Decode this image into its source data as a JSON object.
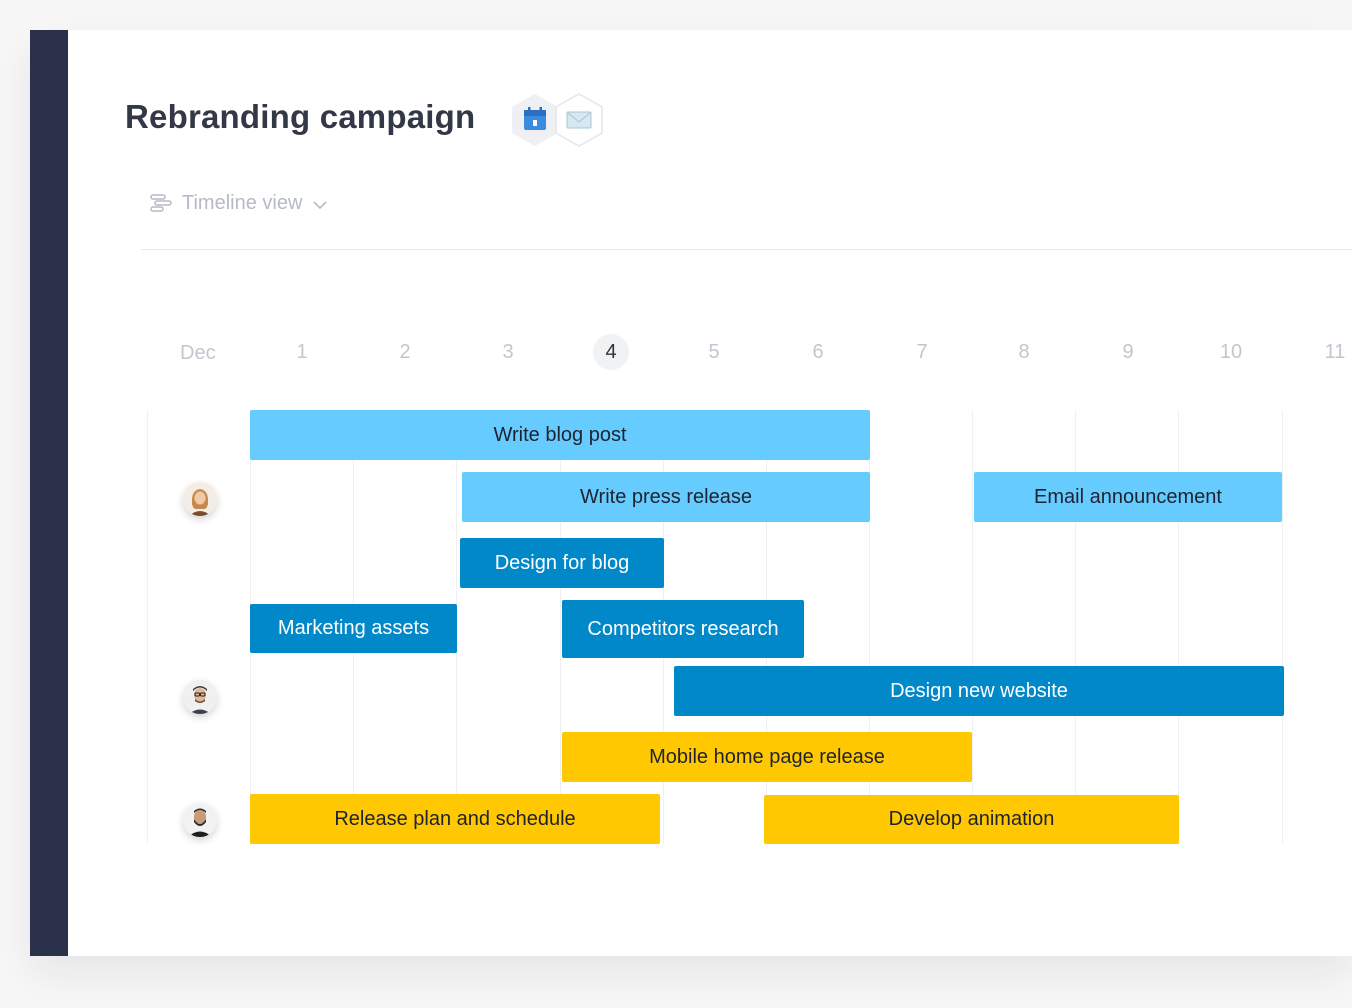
{
  "project": {
    "title": "Rebranding campaign",
    "integrations": [
      "calendar-icon",
      "mail-icon"
    ]
  },
  "view_switch": {
    "label": "Timeline view",
    "icon": "timeline-icon",
    "dropdown_icon": "chevron-down-icon"
  },
  "timeline": {
    "month": "Dec",
    "days": [
      "1",
      "2",
      "3",
      "4",
      "5",
      "6",
      "7",
      "8",
      "9",
      "10",
      "11"
    ],
    "today": "4"
  },
  "assignees": [
    "woman-avatar",
    "man-glasses-avatar",
    "man-beard-avatar"
  ],
  "tasks": [
    {
      "label": "Write blog post",
      "color": "#66ccff"
    },
    {
      "label": "Write press release",
      "color": "#66ccff"
    },
    {
      "label": "Email announcement",
      "color": "#66ccff"
    },
    {
      "label": "Design for blog",
      "color": "#0088c8"
    },
    {
      "label": "Marketing assets",
      "color": "#0088c8"
    },
    {
      "label": "Competitors research",
      "color": "#0088c8"
    },
    {
      "label": "Design new website",
      "color": "#0088c8"
    },
    {
      "label": "Mobile home page release",
      "color": "#ffc800"
    },
    {
      "label": "Release plan and schedule",
      "color": "#ffc800"
    },
    {
      "label": "Develop animation",
      "color": "#ffc800"
    }
  ],
  "colors": {
    "sidebar": "#2b314a",
    "today_bg": "#f1f2f4",
    "muted_text": "#c2c6cf"
  }
}
